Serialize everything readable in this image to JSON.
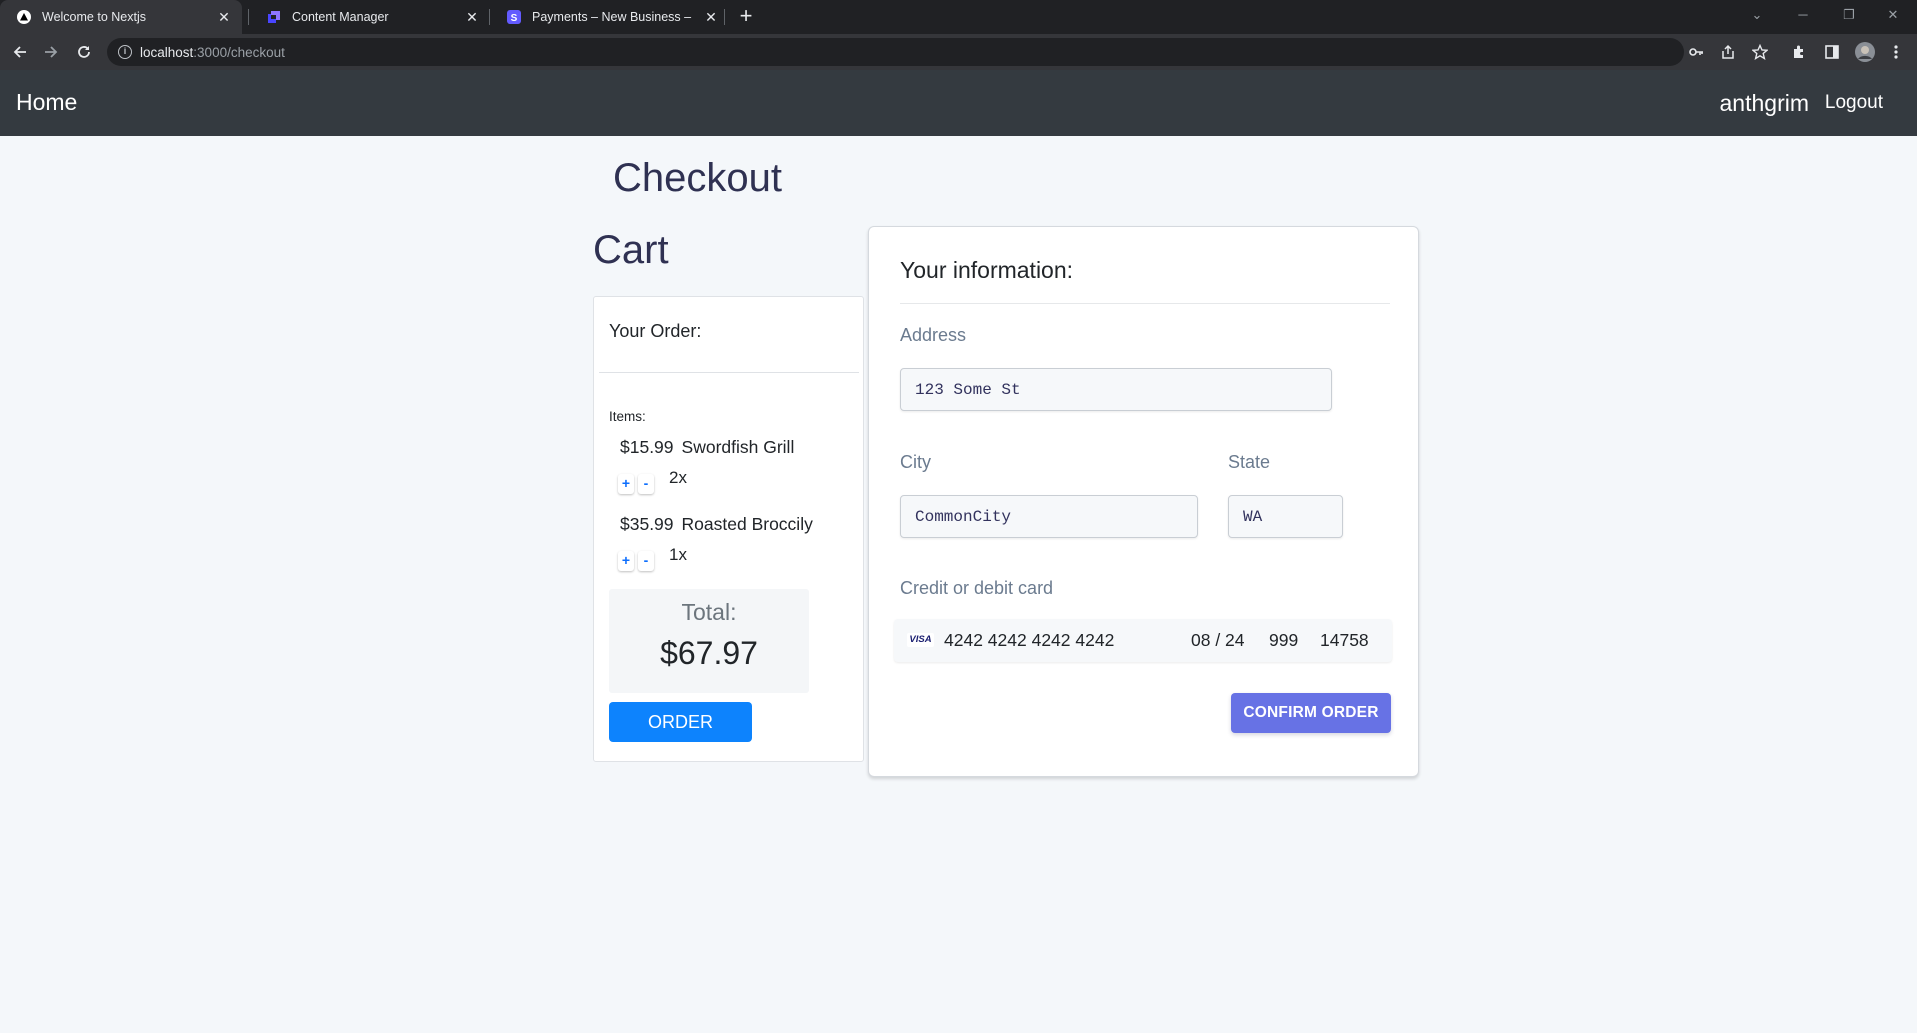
{
  "browser": {
    "tabs": [
      {
        "title": "Welcome to Nextjs",
        "active": true
      },
      {
        "title": "Content Manager",
        "active": false
      },
      {
        "title": "Payments – New Business – Stripe",
        "active": false
      }
    ],
    "url_host": "localhost",
    "url_rest": ":3000/checkout"
  },
  "navbar": {
    "home_label": "Home",
    "username": "anthgrim",
    "logout_label": "Logout"
  },
  "page": {
    "title": "Checkout",
    "cart_title": "Cart"
  },
  "order": {
    "heading": "Your Order:",
    "items_label": "Items:",
    "items": [
      {
        "price": "$15.99",
        "name": "Swordfish Grill",
        "quantity": "2x"
      },
      {
        "price": "$35.99",
        "name": "Roasted Broccily",
        "quantity": "1x"
      }
    ],
    "plus_label": "+",
    "minus_label": "-",
    "total_label": "Total:",
    "total_value": "$67.97",
    "order_button": "ORDER"
  },
  "info": {
    "heading": "Your information:",
    "address_label": "Address",
    "address_value": "123 Some St",
    "city_label": "City",
    "city_value": "CommonCity",
    "state_label": "State",
    "state_value": "WA",
    "card_label": "Credit or debit card",
    "card_brand": "VISA",
    "card_number": "4242 4242 4242 4242",
    "card_expiry": "08 / 24",
    "card_cvc": "999",
    "card_zip": "14758",
    "confirm_button": "CONFIRM ORDER"
  },
  "colors": {
    "navbar_bg": "#343a40",
    "order_button": "#0d83fd",
    "confirm_button": "#6772e5",
    "heading_text": "#2f3152"
  }
}
